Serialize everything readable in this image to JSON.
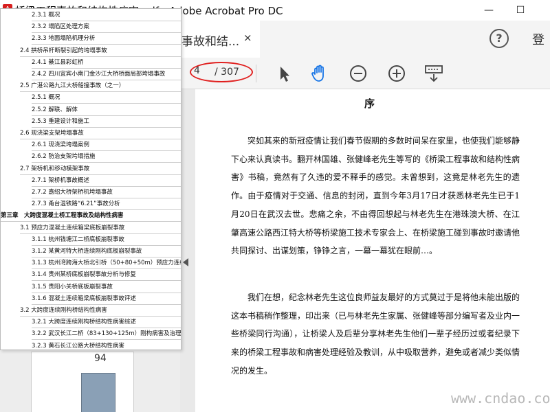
{
  "window": {
    "badge": "A",
    "title": "桥梁工程事故和结构性病害.pdf - Adobe Acrobat Pro DC",
    "minimize": "—",
    "maximize": "☐",
    "close": "✕"
  },
  "tab": {
    "label": "事故和结...",
    "close": "×",
    "help": "?",
    "login": "登"
  },
  "toolbar": {
    "page_current": "4",
    "page_total": "/ 307"
  },
  "thumbnail": {
    "page_number": "94"
  },
  "bookmarks": [
    {
      "level": 3,
      "label": "2.3.1 概况"
    },
    {
      "level": 3,
      "label": "2.3.2 塌陷区处理方案"
    },
    {
      "level": 3,
      "label": "2.3.3 地面塌陷机理分析"
    },
    {
      "level": 2,
      "label": "2.4 拱桥吊杆断裂引起的垮塌事故"
    },
    {
      "level": 3,
      "label": "2.4.1 綦江县彩虹桥"
    },
    {
      "level": 3,
      "label": "2.4.2 四川宜宾小南门金沙江大桥桥面局部垮塌事故"
    },
    {
      "level": 2,
      "label": "2.5 广湛公路九江大桥船撞事故（之一）"
    },
    {
      "level": 3,
      "label": "2.5.1 概况"
    },
    {
      "level": 3,
      "label": "2.5.2 解联、解体"
    },
    {
      "level": 3,
      "label": "2.5.3 重建设计和施工"
    },
    {
      "level": 2,
      "label": "2.6 现浇梁支架垮塌事故"
    },
    {
      "level": 3,
      "label": "2.6.1 现浇梁垮塌案例"
    },
    {
      "level": 3,
      "label": "2.6.2 防治支架垮塌措施"
    },
    {
      "level": 2,
      "label": "2.7 架桥机和移动模架事故"
    },
    {
      "level": 3,
      "label": "2.7.1 架桥机事故概述"
    },
    {
      "level": 3,
      "label": "2.7.2 嘉绍大桥架桥机垮塌事故"
    },
    {
      "level": 3,
      "label": "2.7.3 甬台温铁路“6.21”事故分析"
    },
    {
      "level": 1,
      "label": "第三章　大跨度混凝土桥工程事故及结构性病害"
    },
    {
      "level": 2,
      "label": "3.1 预应力混凝土连续箱梁底板崩裂事故"
    },
    {
      "level": 3,
      "label": "3.1.1 杭州钱塘江二桥底板崩裂事故"
    },
    {
      "level": 3,
      "label": "3.1.2 某黄河特大桥连续刚构底板崩裂事故"
    },
    {
      "level": 3,
      "label": "3.1.3 杭州湾跨海大桥北引桥（50+80+50m）预应力连续"
    },
    {
      "level": 3,
      "label": "3.1.4 贵州某桥底板崩裂事故分析与修复"
    },
    {
      "level": 3,
      "label": "3.1.5 贵阳小关桥底板崩裂事故"
    },
    {
      "level": 3,
      "label": "3.1.6 混凝土连续箱梁底板崩裂事故评述"
    },
    {
      "level": 2,
      "label": "3.2 大跨度连续刚构桥结构性病害"
    },
    {
      "level": 3,
      "label": "3.2.1 大跨度连续刚构桥结构性病害综述"
    },
    {
      "level": 3,
      "label": "3.2.2 武汉长江二桥（83+130+125m）刚构病害及治理"
    },
    {
      "level": 3,
      "label": "3.2.3 黄石长江公路大桥结构性病害"
    }
  ],
  "page": {
    "title": "序",
    "paragraphs": [
      "突如其来的新冠疫情让我们春节假期的多数时间呆在家里，也使我们能够静下心来认真读书。翻开林国雄、张健峰老先生等写的《桥梁工程事故和结构性病害》书稿，竟然有了久违的爱不释手的感觉。未曾想到，这竟是林老先生的遗作。由于疫情对于交通、信息的封闭，直到今年3月17日才获悉林老先生已于1月20日在武汉去世。悲痛之余，不由得回想起与林老先生在港珠澳大桥、在江肇高速公路西江特大桥等桥梁施工技术专家会上、在桥梁施工碰到事故时邀请他共同探讨、出谋划策，铮铮之言，一幕一幕犹在眼前…。",
      "我们在想，纪念林老先生这位良师益友最好的方式莫过于是将他未能出版的这本书稿稍作整理，印出来（已与林老先生家属、张健峰等部分编写者及业内一些桥梁同行沟通），让桥梁人及后辈分享林老先生他们一辈子经历过或者纪录下来的桥梁工程事故和病害处理经验及教训，从中吸取营养，避免或者减少类似情况的发生。"
    ]
  },
  "watermark": "www.cndao.com",
  "colors": {
    "annotation_ellipse": "#e0201f",
    "toolbar_bg": "#f4f4f4",
    "badge_red": "#d71f1f"
  }
}
